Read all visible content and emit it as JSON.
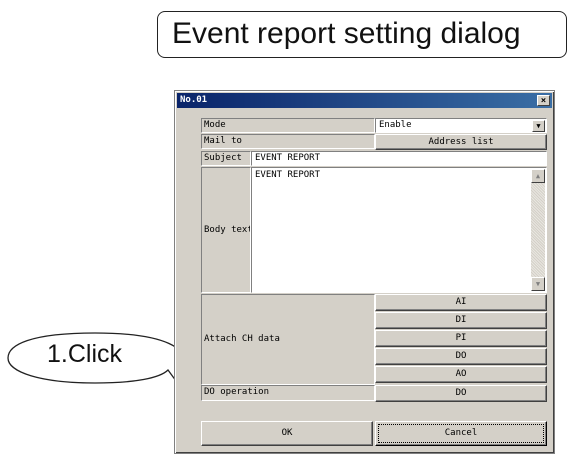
{
  "page_title": "Event report setting dialog",
  "callout": {
    "text": "1.Click"
  },
  "dialog": {
    "title": "No.01",
    "close_label": "×",
    "mode_label": "Mode",
    "mode_value": "Enable",
    "mail_to_label": "Mail to",
    "address_list_label": "Address list",
    "subject_label": "Subject",
    "subject_value": "EVENT REPORT",
    "body_label": "Body text",
    "body_value": "EVENT REPORT",
    "attach_label": "Attach CH data",
    "attach_buttons": [
      "AI",
      "DI",
      "PI",
      "DO",
      "AO"
    ],
    "do_operation_label": "DO operation",
    "do_operation_button": "DO",
    "ok_label": "OK",
    "cancel_label": "Cancel"
  }
}
